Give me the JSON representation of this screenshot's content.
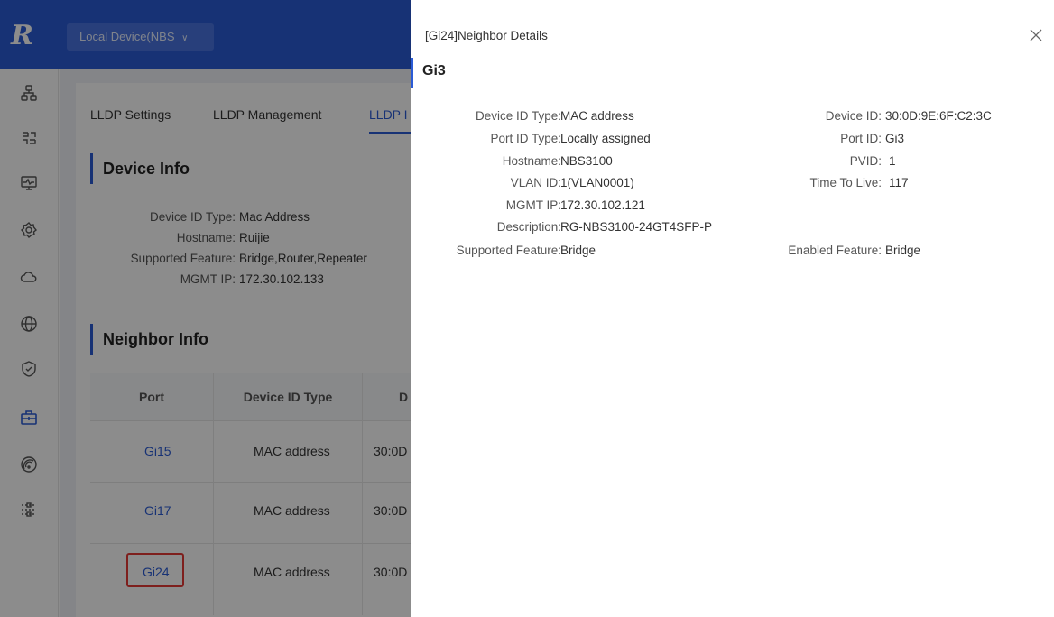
{
  "header": {
    "logo": "R",
    "device_select": "Local Device(NBS",
    "device_select_chevron": "∨"
  },
  "sidebar": {
    "icons": [
      "topology-icon",
      "switch-icon",
      "monitor-icon",
      "settings-icon",
      "cloud-icon",
      "globe-icon",
      "shield-icon",
      "toolbox-icon",
      "wireless-icon",
      "sliders-icon"
    ]
  },
  "tabs": [
    "LLDP Settings",
    "LLDP Management",
    "LLDP I"
  ],
  "device_info": {
    "title": "Device Info",
    "items": [
      {
        "label": "Device ID Type:",
        "value": "Mac Address"
      },
      {
        "label": "Hostname:",
        "value": "Ruijie"
      },
      {
        "label": "Supported Feature:",
        "value": "Bridge,Router,Repeater"
      },
      {
        "label": "MGMT IP:",
        "value": "172.30.102.133"
      }
    ]
  },
  "neighbor_info": {
    "title": "Neighbor Info",
    "columns": [
      "Port",
      "Device ID Type",
      "D"
    ],
    "rows": [
      {
        "port": "Gi15",
        "type": "MAC address",
        "id": "30:0D"
      },
      {
        "port": "Gi17",
        "type": "MAC address",
        "id": "30:0D"
      },
      {
        "port": "Gi24",
        "type": "MAC address",
        "id": "30:0D"
      }
    ]
  },
  "drawer": {
    "header": "[Gi24]Neighbor Details",
    "title": "Gi3",
    "left": [
      {
        "label": "Device ID Type:",
        "value": "MAC address"
      },
      {
        "label": "Port ID Type:",
        "value": "Locally assigned"
      },
      {
        "label": "Hostname:",
        "value": "NBS3100"
      },
      {
        "label": "VLAN ID:",
        "value": "1(VLAN0001)"
      },
      {
        "label": "MGMT IP:",
        "value": "172.30.102.121"
      },
      {
        "label": "Description:",
        "value": "RG-NBS3100-24GT4SFP-P"
      },
      {
        "label": "Supported Feature:",
        "value": "Bridge"
      }
    ],
    "right": [
      {
        "label": "Device ID:",
        "value": "30:0D:9E:6F:C2:3C"
      },
      {
        "label": "Port ID:",
        "value": "Gi3"
      },
      {
        "label": "PVID:",
        "value": "1"
      },
      {
        "label": "Time To Live:",
        "value": "117"
      },
      {
        "label": "Enabled Feature:",
        "value": "Bridge"
      }
    ]
  },
  "colors": {
    "primary": "#2b5bd6",
    "highlight": "#e53935"
  }
}
